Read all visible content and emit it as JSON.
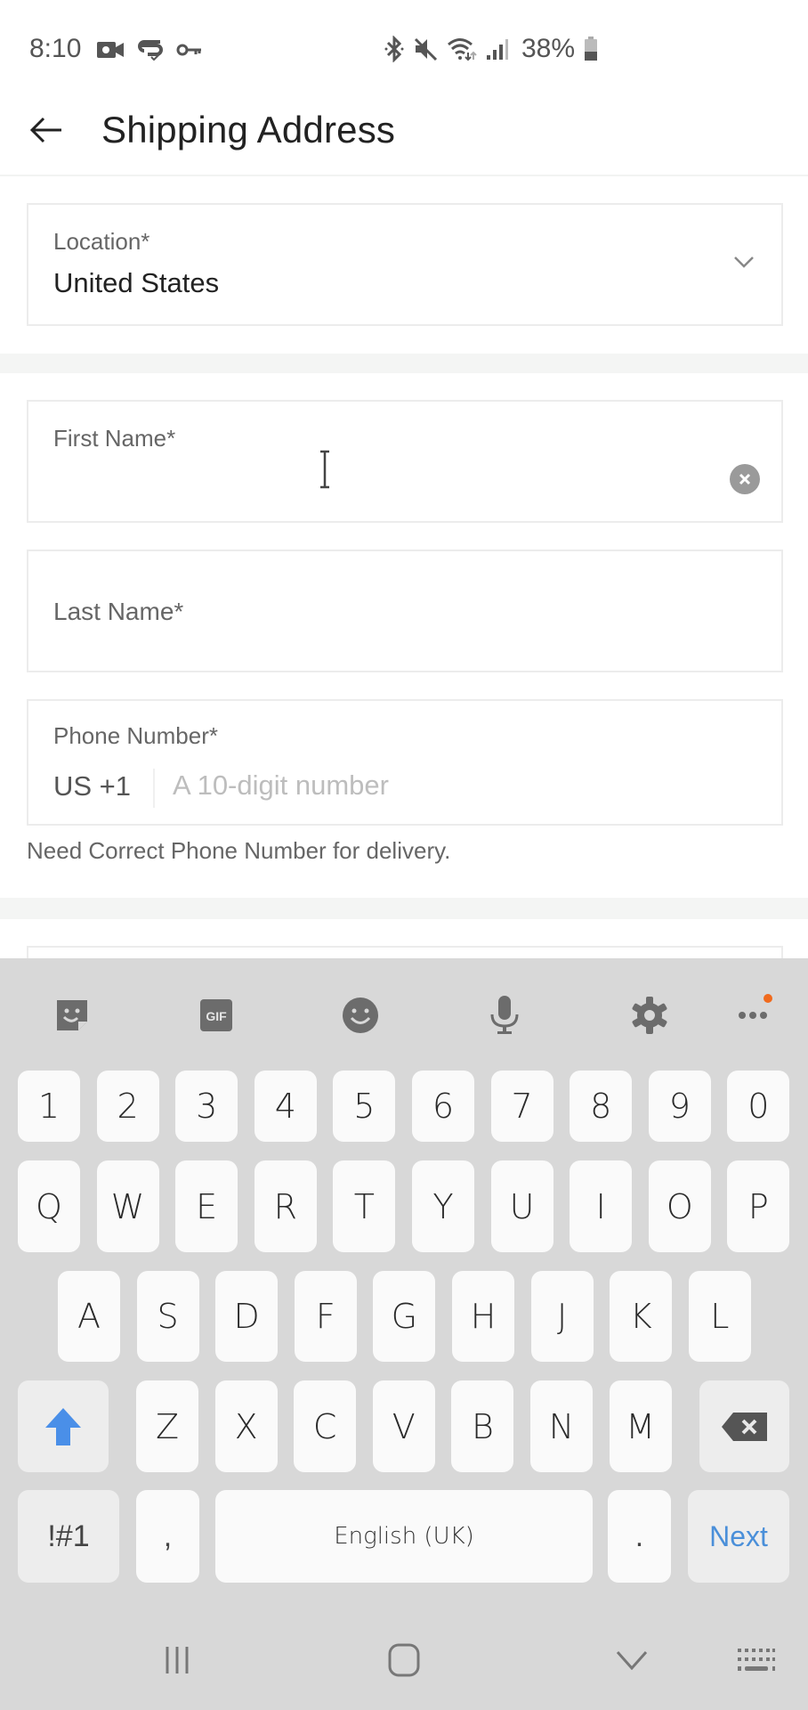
{
  "status_bar": {
    "time": "8:10",
    "left_icons": [
      "video-camera-icon",
      "cast-check-icon",
      "vpn-key-icon"
    ],
    "right_icons": [
      "bluetooth-icon",
      "mute-icon",
      "wifi-icon",
      "signal-icon"
    ],
    "battery_percent": "38%"
  },
  "header": {
    "back_icon": "arrow-left-icon",
    "title": "Shipping Address"
  },
  "form": {
    "location": {
      "label": "Location*",
      "value": "United States",
      "icon": "chevron-down-icon"
    },
    "first_name": {
      "label": "First Name*",
      "value": "",
      "clear_icon": "clear-circle-icon"
    },
    "last_name": {
      "label": "Last Name*",
      "value": ""
    },
    "phone": {
      "label": "Phone Number*",
      "country_code": "US +1",
      "placeholder": "A 10-digit number",
      "value": "",
      "help_text": "Need Correct Phone Number for delivery."
    }
  },
  "keyboard": {
    "toolbar": [
      {
        "name": "sticker-icon",
        "label": "Stickers"
      },
      {
        "name": "gif-icon",
        "label": "GIF"
      },
      {
        "name": "emoji-icon",
        "label": "Emoji"
      },
      {
        "name": "microphone-icon",
        "label": "Voice input"
      },
      {
        "name": "settings-icon",
        "label": "Settings"
      },
      {
        "name": "more-icon",
        "label": "More",
        "has_notification": true
      }
    ],
    "rows": [
      [
        "1",
        "2",
        "3",
        "4",
        "5",
        "6",
        "7",
        "8",
        "9",
        "0"
      ],
      [
        "Q",
        "W",
        "E",
        "R",
        "T",
        "Y",
        "U",
        "I",
        "O",
        "P"
      ],
      [
        "A",
        "S",
        "D",
        "F",
        "G",
        "H",
        "J",
        "K",
        "L"
      ],
      [
        "Z",
        "X",
        "C",
        "V",
        "B",
        "N",
        "M"
      ]
    ],
    "shift_icon": "shift-arrow-icon",
    "backspace_icon": "backspace-icon",
    "symbols_label": "!#1",
    "comma_label": ",",
    "space_label": "English (UK)",
    "period_label": ".",
    "action_label": "Next",
    "accent_color": "#4a8fd9"
  },
  "nav_bar": {
    "buttons": [
      "recent-apps-icon",
      "home-icon",
      "hide-keyboard-icon",
      "keyboard-switch-icon"
    ]
  }
}
